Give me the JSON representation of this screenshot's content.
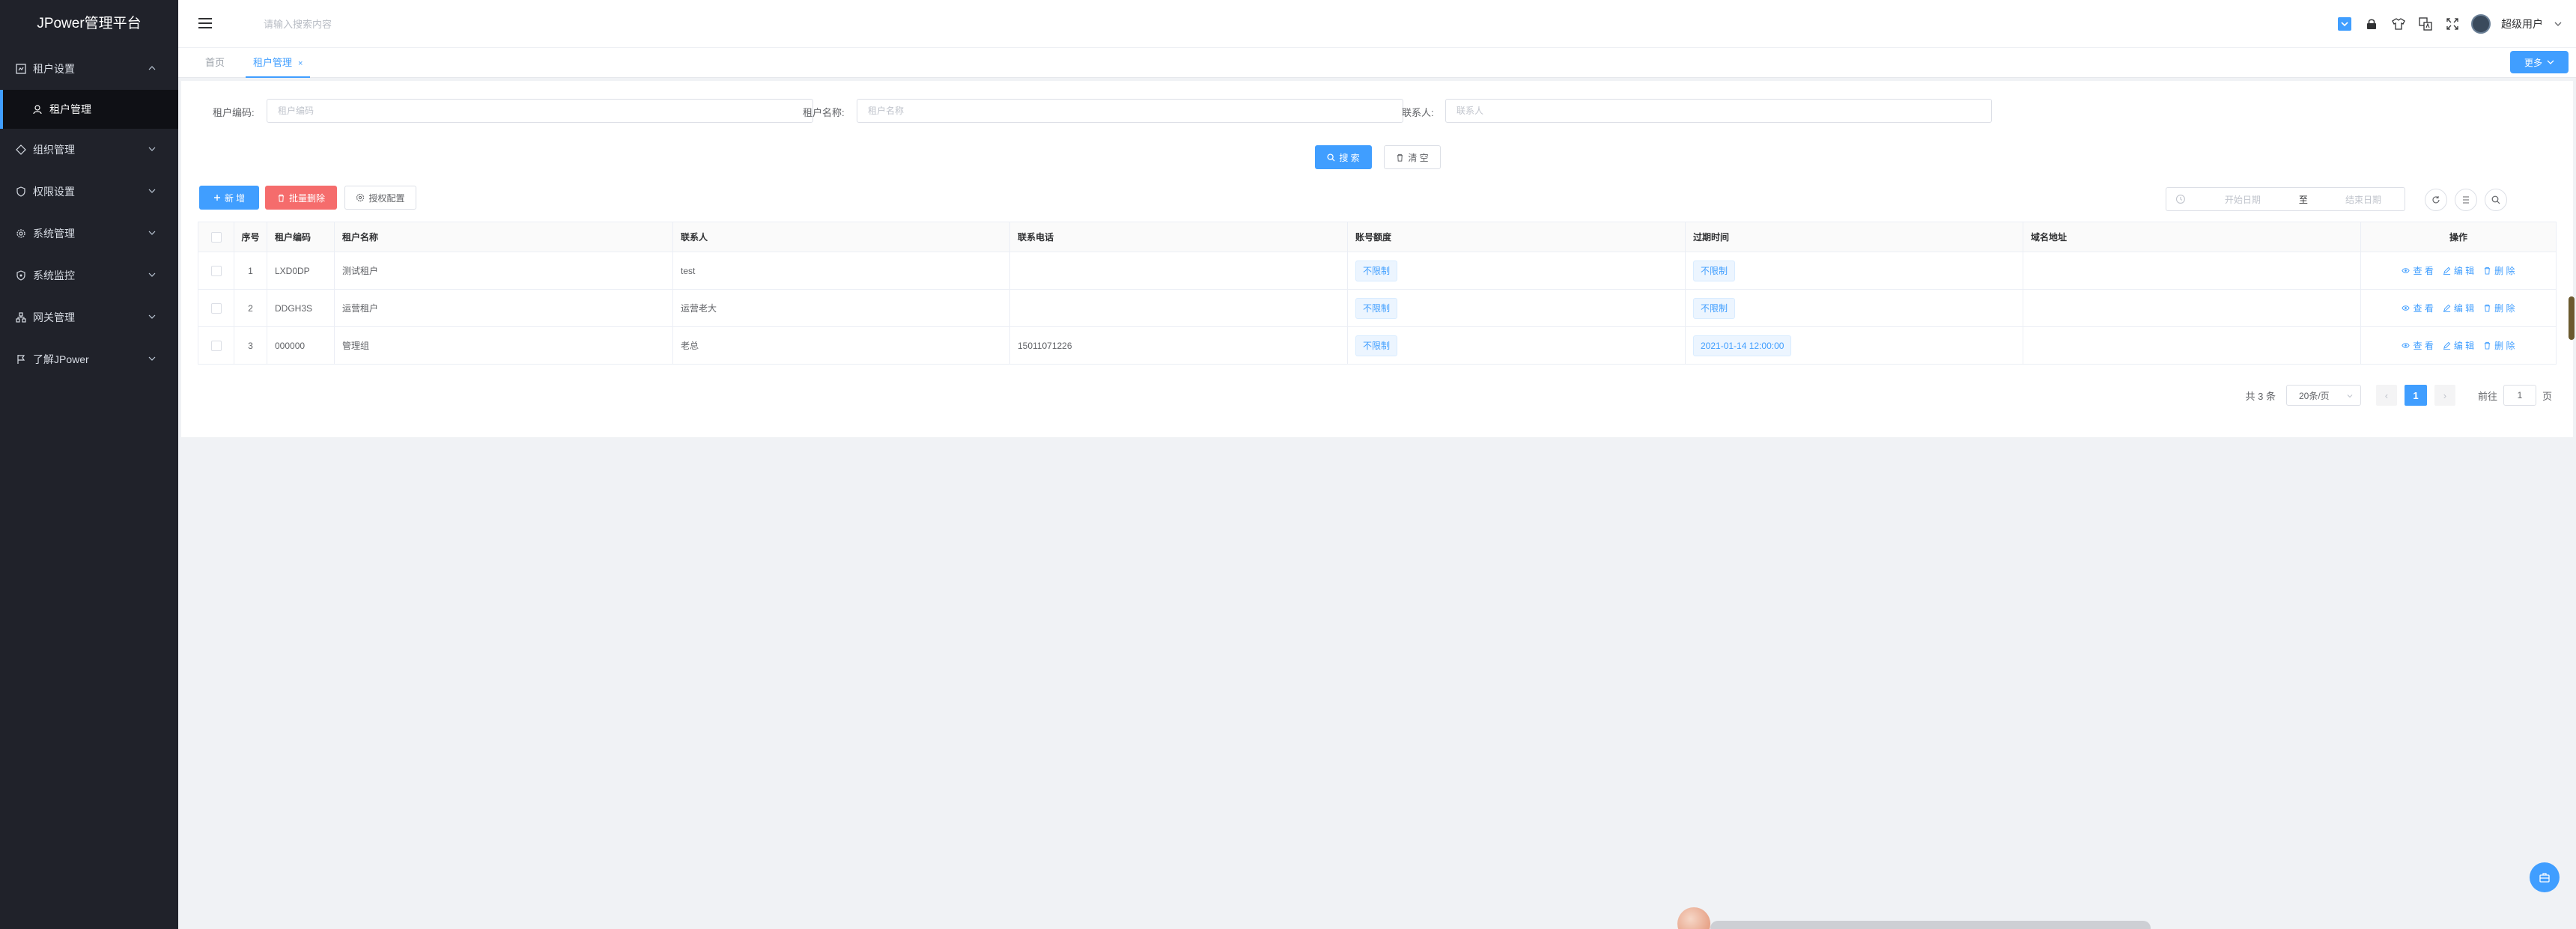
{
  "app": {
    "title": "JPower管理平台"
  },
  "sidebar": {
    "items": [
      {
        "label": "租户设置",
        "icon": "tenant-settings-icon",
        "expanded": true
      },
      {
        "label": "组织管理",
        "icon": "organization-icon"
      },
      {
        "label": "权限设置",
        "icon": "permission-icon"
      },
      {
        "label": "系统管理",
        "icon": "gear-icon"
      },
      {
        "label": "系统监控",
        "icon": "monitor-icon"
      },
      {
        "label": "网关管理",
        "icon": "gateway-icon"
      },
      {
        "label": "了解JPower",
        "icon": "flag-icon"
      }
    ],
    "subitems": [
      {
        "label": "租户管理",
        "icon": "user-icon",
        "active": true
      }
    ]
  },
  "header": {
    "search_placeholder": "请输入搜索内容",
    "user_name": "超级用户"
  },
  "tabs": [
    {
      "label": "首页",
      "active": false
    },
    {
      "label": "租户管理",
      "active": true,
      "close": "×"
    }
  ],
  "tabs_more": "更多",
  "search_form": {
    "code_label": "租户编码:",
    "code_placeholder": "租户编码",
    "name_label": "租户名称:",
    "name_placeholder": "租户名称",
    "contact_label": "联系人:",
    "contact_placeholder": "联系人",
    "search_button": "搜 索",
    "clear_button": "清 空"
  },
  "toolbar": {
    "add_button": "新 增",
    "batch_delete_button": "批量删除",
    "auth_config_button": "授权配置",
    "date_start_placeholder": "开始日期",
    "date_separator": "至",
    "date_end_placeholder": "结束日期"
  },
  "table": {
    "headers": [
      "序号",
      "租户编码",
      "租户名称",
      "联系人",
      "联系电话",
      "账号额度",
      "过期时间",
      "域名地址",
      "操作"
    ],
    "rows": [
      {
        "no": "1",
        "code": "LXD0DP",
        "name": "测试租户",
        "contact": "test",
        "phone": "",
        "quota": "不限制",
        "expire": "不限制",
        "domain": ""
      },
      {
        "no": "2",
        "code": "DDGH3S",
        "name": "运营租户",
        "contact": "运营老大",
        "phone": "",
        "quota": "不限制",
        "expire": "不限制",
        "domain": ""
      },
      {
        "no": "3",
        "code": "000000",
        "name": "管理组",
        "contact": "老总",
        "phone": "15011071226",
        "quota": "不限制",
        "expire": "2021-01-14 12:00:00",
        "domain": ""
      }
    ],
    "ops": {
      "view": "查 看",
      "edit": "编 辑",
      "delete": "删 除"
    }
  },
  "pagination": {
    "total": "共 3 条",
    "page_size": "20条/页",
    "prev": "‹",
    "current": "1",
    "next": "›",
    "goto_label": "前往",
    "goto_value": "1",
    "page_suffix": "页"
  },
  "colors": {
    "primary": "#409eff",
    "danger": "#f56c6c",
    "sidebar_bg": "#20222a"
  }
}
